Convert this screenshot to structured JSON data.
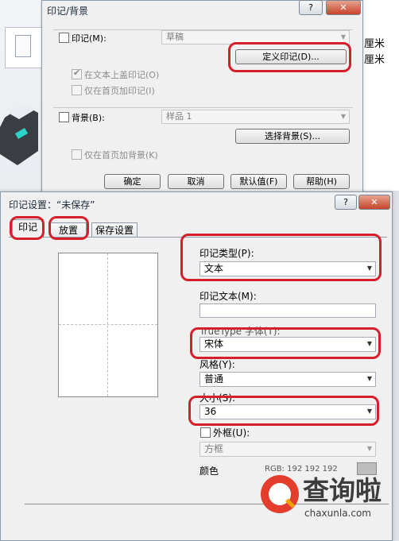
{
  "background": {
    "right_units": [
      "厘米",
      "厘米"
    ]
  },
  "watermark_dialog": {
    "title": "印记/背景",
    "help_button": "?",
    "close_button": "✕",
    "stamp_checkbox": "印记(M):",
    "stamp_select": "草稿",
    "define_stamp_button": "定义印记(D)...",
    "stamp_on_text_checkbox": "在文本上盖印记(O)",
    "stamp_first_page_checkbox": "仅在首页加印记(I)",
    "background_checkbox": "背景(B):",
    "background_select": "样品 1",
    "choose_background_button": "选择背景(S)...",
    "background_first_page_checkbox": "仅在首页加背景(K)",
    "ok_button": "确定",
    "cancel_button": "取消",
    "default_button": "默认值(F)",
    "help_bottom_button": "帮助(H)"
  },
  "stamp_settings_dialog": {
    "title": "印记设置：“未保存”",
    "help_button": "?",
    "close_button": "✕",
    "tabs": [
      "印记",
      "放置",
      "保存设置"
    ],
    "stamp_type_label": "印记类型(P):",
    "stamp_type_value": "文本",
    "stamp_text_label": "印记文本(M):",
    "stamp_text_value": "",
    "font_label": "TrueType 字体(T):",
    "font_value": "宋体",
    "style_label": "风格(Y):",
    "style_value": "普通",
    "size_label": "大小(S):",
    "size_value": "36",
    "frame_checkbox": "外框(U):",
    "frame_select": "方框",
    "color_label": "颜色",
    "rgb_text": "RGB:  192   192   192"
  },
  "watermark_logo": {
    "chinese": "查询啦",
    "url": "chaxunla.com"
  },
  "colors": {
    "annotation_red": "#d61f2b",
    "dialog_bg": "#f0f0f0"
  }
}
